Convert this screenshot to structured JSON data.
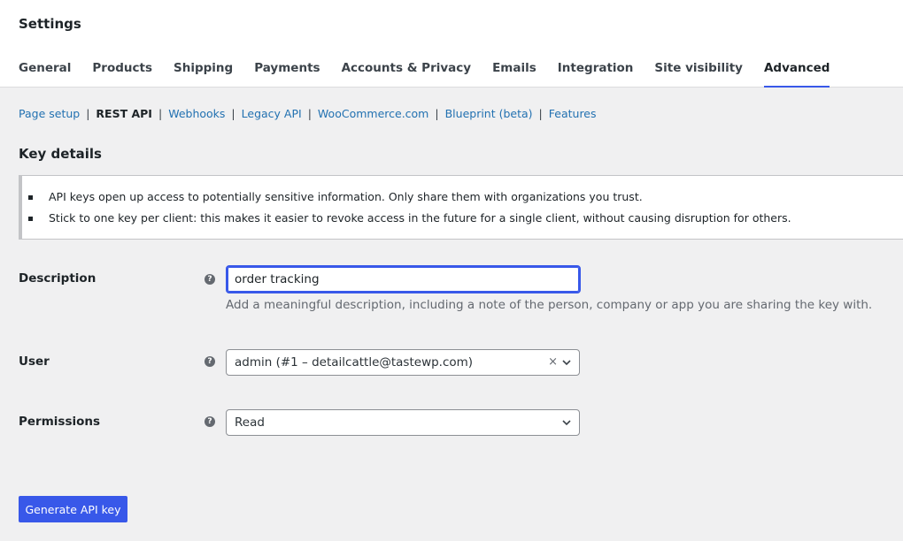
{
  "page": {
    "title": "Settings"
  },
  "tabs": [
    {
      "label": "General"
    },
    {
      "label": "Products"
    },
    {
      "label": "Shipping"
    },
    {
      "label": "Payments"
    },
    {
      "label": "Accounts & Privacy"
    },
    {
      "label": "Emails"
    },
    {
      "label": "Integration"
    },
    {
      "label": "Site visibility"
    },
    {
      "label": "Advanced",
      "active": true
    }
  ],
  "subnav": {
    "items": [
      {
        "label": "Page setup"
      },
      {
        "label": "REST API",
        "current": true
      },
      {
        "label": "Webhooks"
      },
      {
        "label": "Legacy API"
      },
      {
        "label": "WooCommerce.com"
      },
      {
        "label": "Blueprint (beta)"
      },
      {
        "label": "Features"
      }
    ],
    "separator": "|"
  },
  "section": {
    "title": "Key details"
  },
  "notice": {
    "items": [
      "API keys open up access to potentially sensitive information. Only share them with organizations you trust.",
      "Stick to one key per client: this makes it easier to revoke access in the future for a single client, without causing disruption for others."
    ]
  },
  "form": {
    "help_glyph": "?",
    "description": {
      "label": "Description",
      "value": "order tracking",
      "hint": "Add a meaningful description, including a note of the person, company or app you are sharing the key with."
    },
    "user": {
      "label": "User",
      "value": "admin (#1 – detailcattle@tastewp.com)",
      "clear_glyph": "×"
    },
    "permissions": {
      "label": "Permissions",
      "value": "Read"
    },
    "submit_label": "Generate API key"
  },
  "colors": {
    "accent": "#3858e9",
    "link": "#2271b1",
    "background": "#f0f0f1"
  }
}
